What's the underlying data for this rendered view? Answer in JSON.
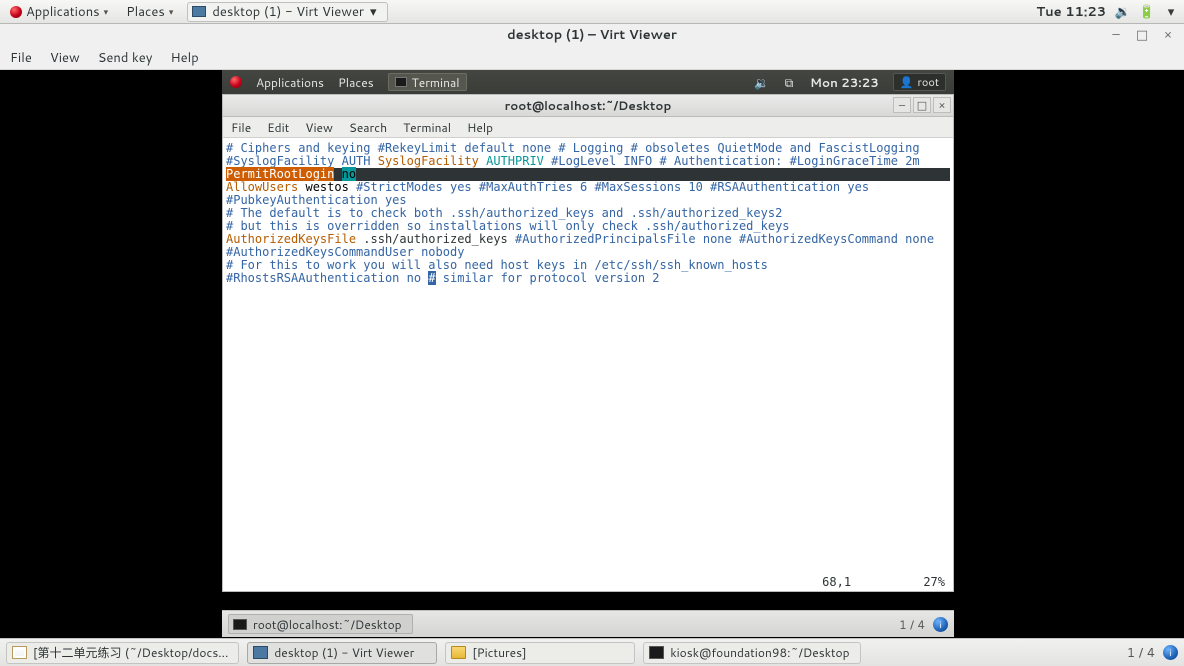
{
  "host_panel": {
    "apps_label": "Applications",
    "places_label": "Places",
    "task_label": "desktop (1) - Virt Viewer",
    "clock": "Tue 11:23"
  },
  "vv": {
    "title": "desktop (1) – Virt Viewer",
    "menus": {
      "file": "File",
      "view": "View",
      "sendkey": "Send key",
      "help": "Help"
    }
  },
  "guest_panel": {
    "apps": "Applications",
    "places": "Places",
    "term_task": "Terminal",
    "clock": "Mon 23:23",
    "user": "root"
  },
  "terminal": {
    "title": "root@localhost:~/Desktop",
    "menus": {
      "file": "File",
      "edit": "Edit",
      "view": "View",
      "search": "Search",
      "terminal": "Terminal",
      "help": "Help"
    },
    "lines": {
      "l01": "# Ciphers and keying",
      "l02": "#RekeyLimit default none",
      "l03": "",
      "l04": "# Logging",
      "l05": "# obsoletes QuietMode and FascistLogging",
      "l06": "#SyslogFacility AUTH",
      "l07a": "SyslogFacility ",
      "l07b": "AUTHPRIV",
      "l08": "#LogLevel INFO",
      "l09": "",
      "l10": "# Authentication:",
      "l11": "",
      "l12": "#LoginGraceTime 2m",
      "hl_key": "PermitRootLogin",
      "hl_sp": " ",
      "hl_val": "no",
      "l14a": "AllowUsers",
      "l14b": " westos",
      "l15": "#StrictModes yes",
      "l16": "#MaxAuthTries 6",
      "l17": "#MaxSessions 10",
      "l18": "",
      "l19": "#RSAAuthentication yes",
      "l20": "#PubkeyAuthentication yes",
      "l21": "",
      "l22": "# The default is to check both .ssh/authorized_keys and .ssh/authorized_keys2",
      "l23": "# but this is overridden so installations will only check .ssh/authorized_keys",
      "l24a": "AuthorizedKeysFile",
      "l24b": " .ssh/authorized_keys",
      "l25": "",
      "l26": "#AuthorizedPrincipalsFile none",
      "l27": "",
      "l28": "#AuthorizedKeysCommand none",
      "l29": "#AuthorizedKeysCommandUser nobody",
      "l30": "",
      "l31": "# For this to work you will also need host keys in /etc/ssh/ssh_known_hosts",
      "l32": "#RhostsRSAAuthentication no",
      "l33a": "#",
      "l33b": " similar for protocol version 2"
    },
    "status": "68,1          27%"
  },
  "guest_btm": {
    "task": "root@localhost:~/Desktop",
    "ws": "1 / 4"
  },
  "host_btm": {
    "b1": "[第十二单元练习 (~/Desktop/docs...",
    "b2": "desktop (1) - Virt Viewer",
    "b3": "[Pictures]",
    "b4": "kiosk@foundation98:~/Desktop",
    "ws": "1 / 4"
  }
}
